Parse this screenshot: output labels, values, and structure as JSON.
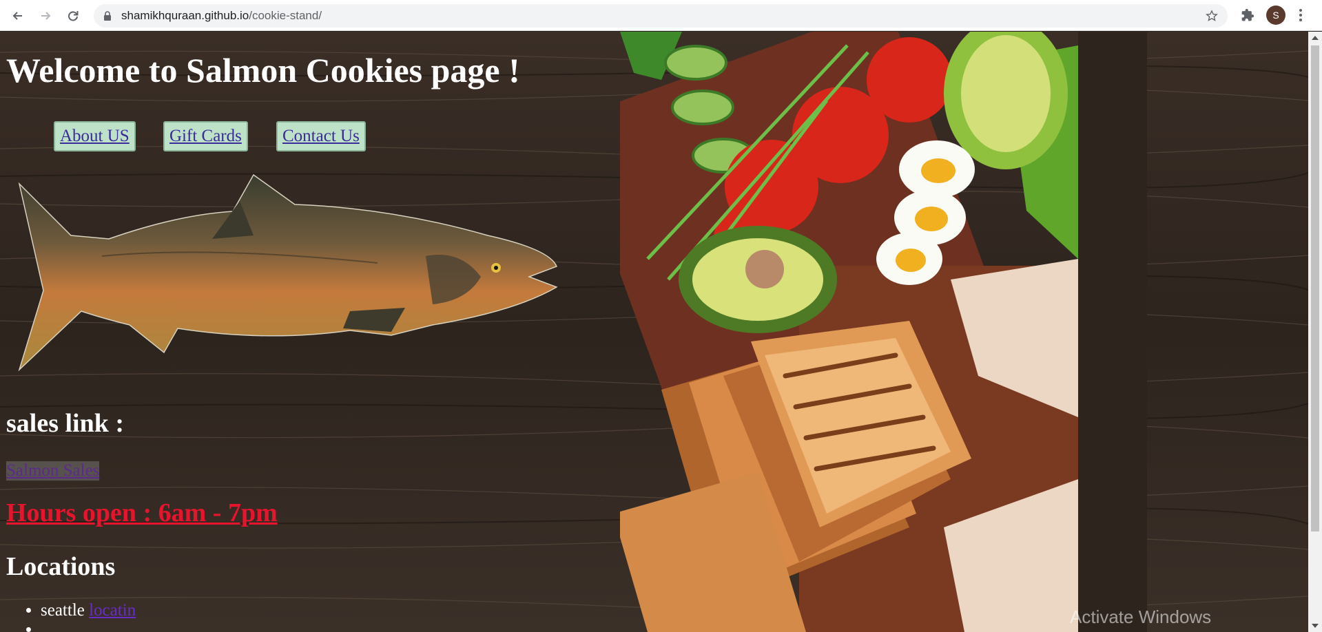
{
  "browser": {
    "url_host": "shamikhquraan.github.io",
    "url_path": "/cookie-stand/",
    "profile_initial": "S",
    "icons": [
      "back-icon",
      "forward-icon",
      "reload-icon",
      "lock-icon",
      "star-icon",
      "extensions-icon",
      "menu-icon"
    ]
  },
  "page": {
    "title": "Welcome to Salmon Cookies page !",
    "nav": [
      {
        "label": "About US"
      },
      {
        "label": "Gift Cards"
      },
      {
        "label": "Contact Us"
      }
    ],
    "sales_heading": "sales link :",
    "sales_link": "Salmon Sales",
    "hours": "Hours open : 6am - 7pm",
    "locations_heading": "Locations",
    "locations": [
      {
        "name": "seattle",
        "link": "locatin"
      },
      {
        "name": "",
        "link": ""
      }
    ]
  },
  "os": {
    "watermark": "Activate Windows"
  },
  "colors": {
    "hours_red": "#e8142d",
    "nav_bg": "#bde2c8",
    "link_purple": "#6a2cc8"
  }
}
